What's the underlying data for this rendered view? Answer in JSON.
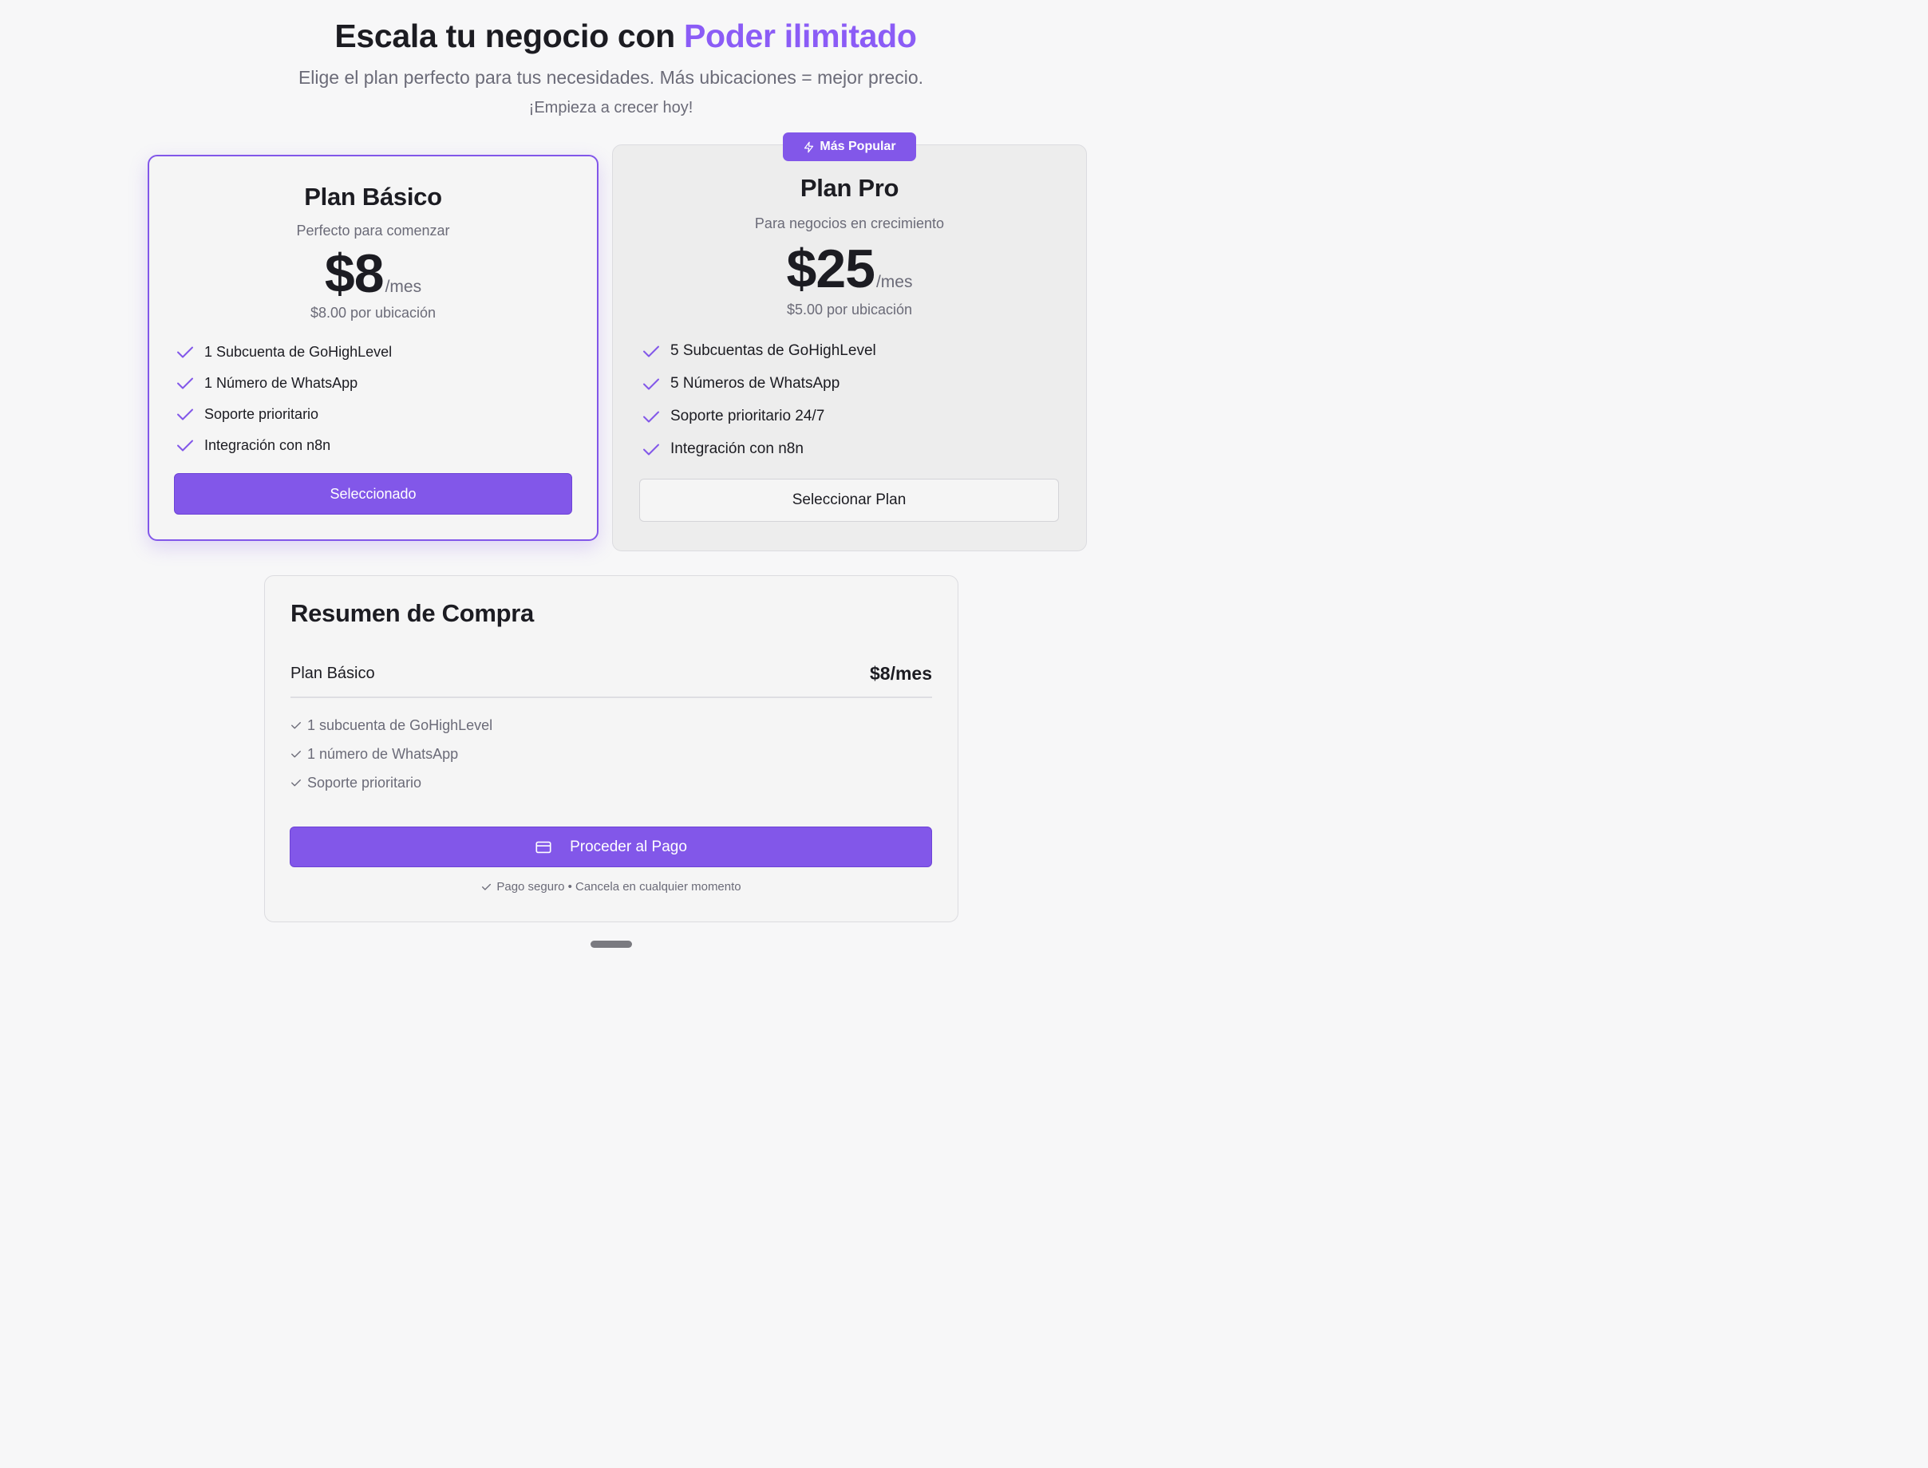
{
  "colors": {
    "accent": "#8257e9",
    "accent_text": "#8b5cf6",
    "muted": "#6b6b78"
  },
  "header": {
    "title_prefix": "Escala tu negocio con ",
    "title_accent": "Poder ilimitado",
    "subtitle": "Elige el plan perfecto para tus necesidades. Más ubicaciones = mejor precio.",
    "tagline": "¡Empieza a crecer hoy!"
  },
  "plans": {
    "basic": {
      "name": "Plan Básico",
      "description": "Perfecto para comenzar",
      "price": "$8",
      "period": "/mes",
      "per_location": "$8.00 por ubicación",
      "features": [
        "1 Subcuenta de GoHighLevel",
        "1 Número de WhatsApp",
        "Soporte prioritario",
        "Integración con n8n"
      ],
      "button_label": "Seleccionado",
      "selected": true
    },
    "pro": {
      "badge": "Más Popular",
      "badge_icon": "lightning-icon",
      "name": "Plan Pro",
      "description": "Para negocios en crecimiento",
      "price": "$25",
      "period": "/mes",
      "per_location": "$5.00 por ubicación",
      "features": [
        "5 Subcuentas de GoHighLevel",
        "5 Números de WhatsApp",
        "Soporte prioritario 24/7",
        "Integración con n8n"
      ],
      "button_label": "Seleccionar Plan",
      "selected": false
    }
  },
  "summary": {
    "title": "Resumen de Compra",
    "plan_name": "Plan Básico",
    "plan_price": "$8/mes",
    "items": [
      "1 subcuenta de GoHighLevel",
      "1 número de WhatsApp",
      "Soporte prioritario"
    ],
    "checkout_label": "Proceder al Pago",
    "checkout_icon": "credit-card-icon",
    "secure_note": "Pago seguro • Cancela en cualquier momento"
  }
}
